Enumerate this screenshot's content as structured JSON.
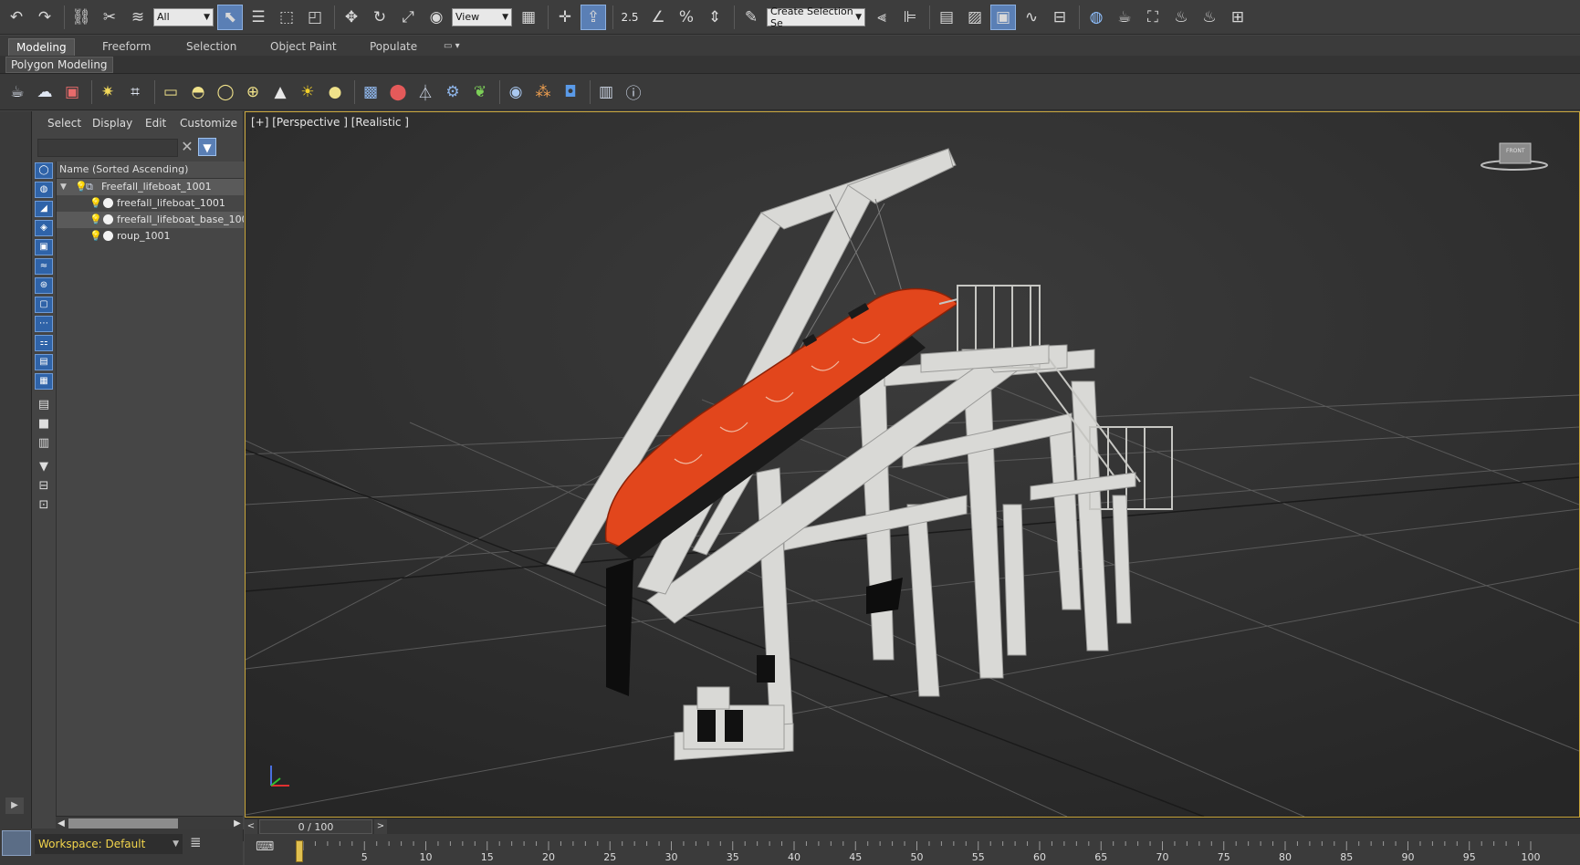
{
  "main_toolbar": {
    "selection_filter": "All",
    "reference_coord": "View",
    "snap_label": "2.5",
    "named_selection_placeholder": "Create Selection Se"
  },
  "ribbon": {
    "tabs": [
      "Modeling",
      "Freeform",
      "Selection",
      "Object Paint",
      "Populate"
    ],
    "active_panel": "Polygon Modeling"
  },
  "explorer": {
    "menu": [
      "Select",
      "Display",
      "Edit",
      "Customize"
    ],
    "column_header": "Name (Sorted Ascending)",
    "root": "Freefall_lifeboat_1001",
    "children": [
      "freefall_lifeboat_1001",
      "freefall_lifeboat_base_100",
      "roup_1001"
    ],
    "workspace": "Workspace: Default"
  },
  "viewport": {
    "label": "[+] [Perspective ] [Realistic ]",
    "viewcube_face": "FRONT"
  },
  "timeline": {
    "frame_display": "0 / 100",
    "ticks": [
      "5",
      "10",
      "15",
      "20",
      "25",
      "30",
      "35",
      "40",
      "45",
      "50",
      "55",
      "60",
      "65",
      "70",
      "75",
      "80",
      "85",
      "90",
      "95",
      "100"
    ]
  },
  "colors": {
    "lifeboat": "#e2461c",
    "structure": "#d9d9d6",
    "viewport_bg": "#2a2a2a",
    "active_border": "#c8a53a",
    "workspace_text": "#f3d54c"
  }
}
